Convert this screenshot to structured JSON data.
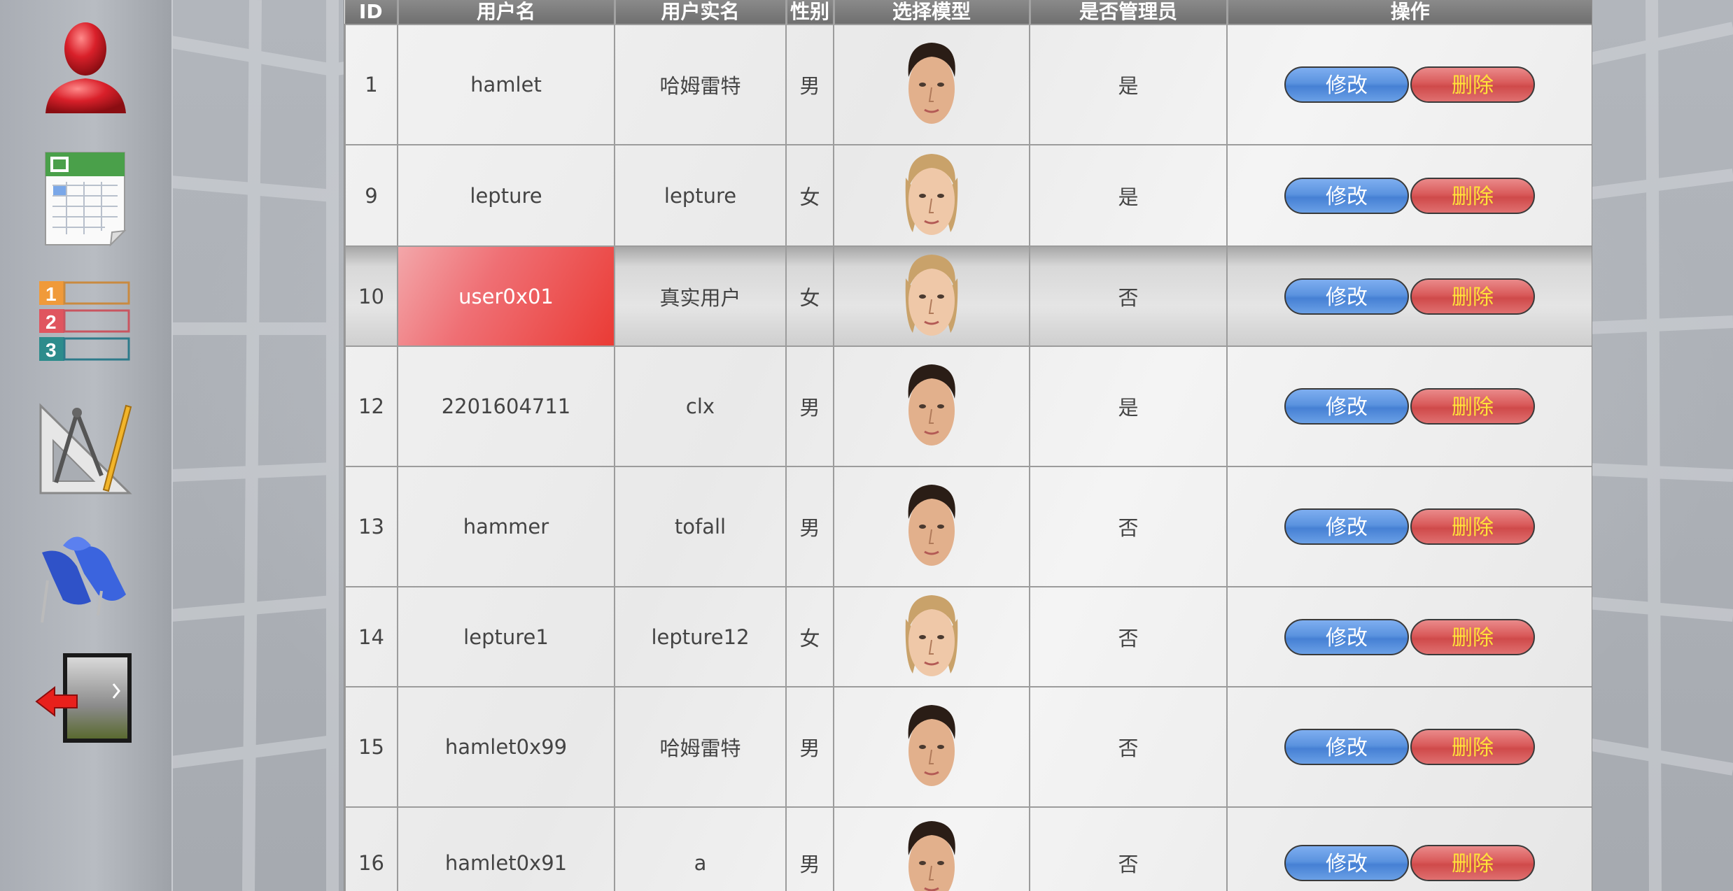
{
  "table": {
    "headers": [
      "ID",
      "用户名",
      "用户实名",
      "性别",
      "选择模型",
      "是否管理员",
      "操作"
    ],
    "edit_label": "修改",
    "delete_label": "删除",
    "rows": [
      {
        "id": "1",
        "username": "hamlet",
        "realname": "哈姆雷特",
        "gender": "男",
        "model": "male",
        "admin": "是"
      },
      {
        "id": "9",
        "username": "lepture",
        "realname": "lepture",
        "gender": "女",
        "model": "female",
        "admin": "是"
      },
      {
        "id": "10",
        "username": "user0x01",
        "realname": "真实用户",
        "gender": "女",
        "model": "female",
        "admin": "否"
      },
      {
        "id": "12",
        "username": "2201604711",
        "realname": "clx",
        "gender": "男",
        "model": "male",
        "admin": "是"
      },
      {
        "id": "13",
        "username": "hammer",
        "realname": "tofall",
        "gender": "男",
        "model": "male",
        "admin": "否"
      },
      {
        "id": "14",
        "username": "lepture1",
        "realname": "lepture12",
        "gender": "女",
        "model": "female",
        "admin": "否"
      },
      {
        "id": "15",
        "username": "hamlet0x99",
        "realname": "哈姆雷特",
        "gender": "男",
        "model": "male",
        "admin": "否"
      },
      {
        "id": "16",
        "username": "hamlet0x91",
        "realname": "a",
        "gender": "男",
        "model": "male",
        "admin": "否"
      }
    ]
  },
  "sidebar": {
    "items": [
      {
        "icon": "user-icon"
      },
      {
        "icon": "spreadsheet-icon"
      },
      {
        "icon": "numbered-list-icon"
      },
      {
        "icon": "drafting-tools-icon"
      },
      {
        "icon": "shoes-icon"
      },
      {
        "icon": "logout-icon"
      }
    ]
  },
  "colors": {
    "header_bg": "#7a7a7a",
    "selected_name_bg": "#ea3b35",
    "edit_button": "#5b93df",
    "delete_button": "#d95a5a",
    "delete_text": "#ffe23a"
  }
}
